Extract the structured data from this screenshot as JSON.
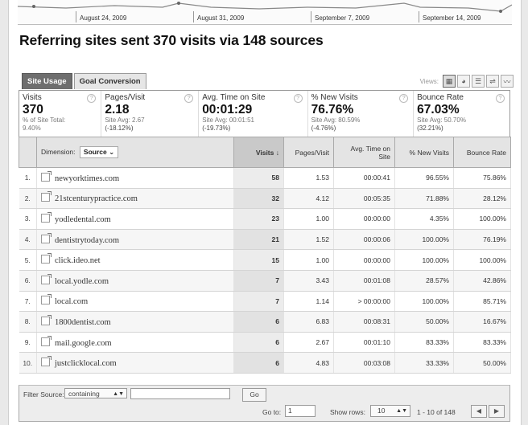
{
  "timeline": {
    "dates": [
      "August 24, 2009",
      "August 31, 2009",
      "September 7, 2009",
      "September 14, 2009"
    ]
  },
  "title": "Referring sites sent 370 visits via 148 sources",
  "tabs": [
    {
      "label": "Site Usage",
      "active": true
    },
    {
      "label": "Goal Conversion",
      "active": false
    }
  ],
  "views_label": "Views:",
  "summary": [
    {
      "label": "Visits",
      "value": "370",
      "sub1": "% of Site Total:",
      "sub2": "9.40%"
    },
    {
      "label": "Pages/Visit",
      "value": "2.18",
      "sub1": "Site Avg: 2.67",
      "sub2": "(-18.12%)"
    },
    {
      "label": "Avg. Time on Site",
      "value": "00:01:29",
      "sub1": "Site Avg: 00:01:51",
      "sub2": "(-19.73%)"
    },
    {
      "label": "% New Visits",
      "value": "76.76%",
      "sub1": "Site Avg: 80.59%",
      "sub2": "(-4.76%)"
    },
    {
      "label": "Bounce Rate",
      "value": "67.03%",
      "sub1": "Site Avg: 50.70%",
      "sub2": "(32.21%)"
    }
  ],
  "table": {
    "dimension_label": "Dimension:",
    "dimension_value": "Source",
    "headers": {
      "visits": "Visits",
      "pages_visit": "Pages/Visit",
      "avg_time": "Avg. Time on Site",
      "new_visits": "% New Visits",
      "bounce": "Bounce Rate"
    },
    "rows": [
      {
        "n": "1.",
        "source": "newyorktimes.com",
        "visits": "58",
        "pv": "1.53",
        "time": "00:00:41",
        "new": "96.55%",
        "bounce": "75.86%"
      },
      {
        "n": "2.",
        "source": "21stcenturypractice.com",
        "visits": "32",
        "pv": "4.12",
        "time": "00:05:35",
        "new": "71.88%",
        "bounce": "28.12%"
      },
      {
        "n": "3.",
        "source": "yodledental.com",
        "visits": "23",
        "pv": "1.00",
        "time": "00:00:00",
        "new": "4.35%",
        "bounce": "100.00%"
      },
      {
        "n": "4.",
        "source": "dentistrytoday.com",
        "visits": "21",
        "pv": "1.52",
        "time": "00:00:06",
        "new": "100.00%",
        "bounce": "76.19%"
      },
      {
        "n": "5.",
        "source": "click.ideo.net",
        "visits": "15",
        "pv": "1.00",
        "time": "00:00:00",
        "new": "100.00%",
        "bounce": "100.00%"
      },
      {
        "n": "6.",
        "source": "local.yodle.com",
        "visits": "7",
        "pv": "3.43",
        "time": "00:01:08",
        "new": "28.57%",
        "bounce": "42.86%"
      },
      {
        "n": "7.",
        "source": "local.com",
        "visits": "7",
        "pv": "1.14",
        "time": "> 00:00:00",
        "new": "100.00%",
        "bounce": "85.71%"
      },
      {
        "n": "8.",
        "source": "1800dentist.com",
        "visits": "6",
        "pv": "6.83",
        "time": "00:08:31",
        "new": "50.00%",
        "bounce": "16.67%"
      },
      {
        "n": "9.",
        "source": "mail.google.com",
        "visits": "6",
        "pv": "2.67",
        "time": "00:01:10",
        "new": "83.33%",
        "bounce": "83.33%"
      },
      {
        "n": "10.",
        "source": "justclicklocal.com",
        "visits": "6",
        "pv": "4.83",
        "time": "00:03:08",
        "new": "33.33%",
        "bounce": "50.00%"
      }
    ]
  },
  "footer": {
    "filter_label": "Filter Source:",
    "filter_mode": "containing",
    "filter_value": "",
    "go_label": "Go",
    "goto_label": "Go to:",
    "goto_value": "1",
    "show_rows_label": "Show rows:",
    "show_rows_value": "10",
    "range": "1 - 10 of 148",
    "prev_glyph": "◀",
    "next_glyph": "▶"
  }
}
